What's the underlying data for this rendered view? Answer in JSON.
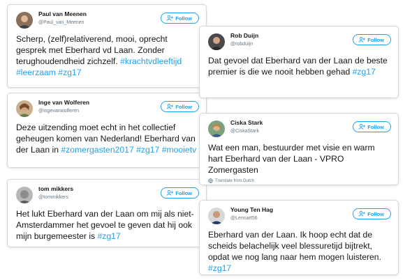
{
  "follow_label": "Follow",
  "tweets": [
    {
      "name": "Paul van Meenen",
      "handle": "@Paul_van_Meenen",
      "segments": [
        {
          "t": "Scherp, (zelf)relativerend, mooi, oprecht gesprek met Eberhard vd Laan. Zonder terughoudendheid zichzelf. "
        },
        {
          "t": "#krachtvdleeftijd",
          "tag": true
        },
        {
          "t": " "
        },
        {
          "t": "#leerzaam",
          "tag": true
        },
        {
          "t": " "
        },
        {
          "t": "#zg17",
          "tag": true
        }
      ]
    },
    {
      "name": "Rob Duijn",
      "handle": "@robduijn",
      "segments": [
        {
          "t": "Dat gevoel dat Eberhard van der Laan de beste premier is die we nooit hebben gehad "
        },
        {
          "t": "#zg17",
          "tag": true
        }
      ]
    },
    {
      "name": "Inge van Wolferen",
      "handle": "@ingevanwolferen",
      "segments": [
        {
          "t": "Deze uitzending moet echt in het collectief geheugen komen van Nederland! Eberhard van der Laan in  "
        },
        {
          "t": "#zomergasten2017",
          "tag": true
        },
        {
          "t": " "
        },
        {
          "t": "#zg17",
          "tag": true
        },
        {
          "t": " "
        },
        {
          "t": "#mooietv",
          "tag": true
        }
      ]
    },
    {
      "name": "Ciska Stark",
      "handle": "@CiskaStark",
      "segments": [
        {
          "t": "Wat een man, bestuurder met visie en warm hart Eberhard van der Laan - VPRO Zomergasten"
        }
      ],
      "translate": "Translate from Dutch"
    },
    {
      "name": "tom mikkers",
      "handle": "@tommikkers",
      "segments": [
        {
          "t": "Het lukt Eberhard van der Laan om mij als niet-Amsterdammer het gevoel te geven dat hij ook mijn burgemeester is "
        },
        {
          "t": "#zg17",
          "tag": true
        }
      ]
    },
    {
      "name": "Young Ten Hag",
      "handle": "@Lennart56",
      "segments": [
        {
          "t": "Eberhard van der Laan. Ik hoop echt dat de scheids belachelijk veel blessuretijd bijtrekt, opdat we nog lang naar hem mogen luisteren. "
        },
        {
          "t": "#zg17",
          "tag": true
        }
      ]
    }
  ]
}
